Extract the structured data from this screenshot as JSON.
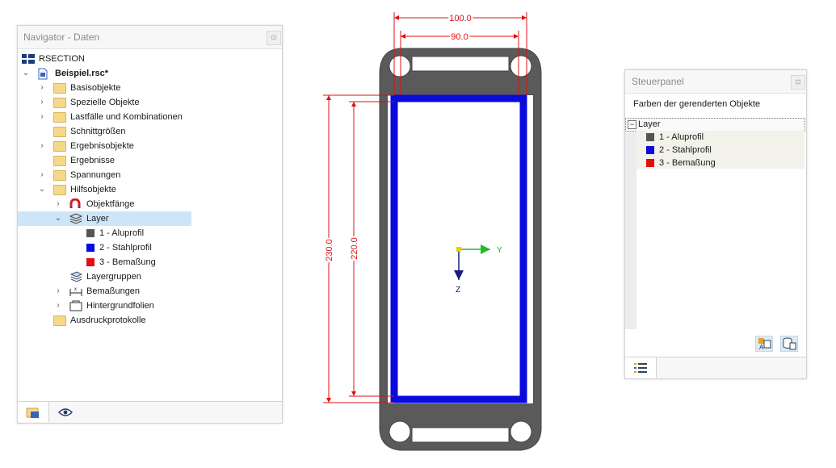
{
  "navigator": {
    "title": "Navigator - Daten",
    "root": "RSECTION",
    "file": "Beispiel.rsc*",
    "items": [
      {
        "label": "Basisobjekte",
        "expandable": true
      },
      {
        "label": "Spezielle Objekte",
        "expandable": true
      },
      {
        "label": "Lastfälle und Kombinationen",
        "expandable": true
      },
      {
        "label": "Schnittgrößen",
        "expandable": false
      },
      {
        "label": "Ergebnisobjekte",
        "expandable": true
      },
      {
        "label": "Ergebnisse",
        "expandable": false
      },
      {
        "label": "Spannungen",
        "expandable": true
      },
      {
        "label": "Hilfsobjekte",
        "expandable": true
      }
    ],
    "hilfsobjekte": {
      "objektfaenge": "Objektfänge",
      "layer": "Layer",
      "layers": [
        {
          "label": "1 - Aluprofil",
          "color": "#555555"
        },
        {
          "label": "2 - Stahlprofil",
          "color": "#0a0adc"
        },
        {
          "label": "3 - Bemaßung",
          "color": "#e01010"
        }
      ],
      "layergruppen": "Layergruppen",
      "bemassungen": "Bemaßungen",
      "hintergrundfolien": "Hintergrundfolien"
    },
    "ausdruck": "Ausdruckprotokolle",
    "tabs": [
      "data-icon",
      "eye-icon"
    ]
  },
  "drawing": {
    "dim_outer_width": "100.0",
    "dim_inner_width": "90.0",
    "dim_outer_height": "230.0",
    "dim_inner_height": "220.0",
    "axis_y": "Y",
    "axis_z": "Z",
    "colors": {
      "dimension": "#e01010",
      "steel": "#0a0adc",
      "alu": "#555555",
      "axis_y": "#22bb22",
      "axis_z": "#1a1a80"
    }
  },
  "steuerpanel": {
    "title": "Steuerpanel",
    "heading": "Farben der gerenderten Objekte",
    "group": "Layer",
    "rows": [
      {
        "label": "1 - Aluprofil",
        "color": "#555555"
      },
      {
        "label": "2 - Stahlprofil",
        "color": "#0a0adc"
      },
      {
        "label": "3 - Bemaßung",
        "color": "#e01010"
      }
    ]
  }
}
